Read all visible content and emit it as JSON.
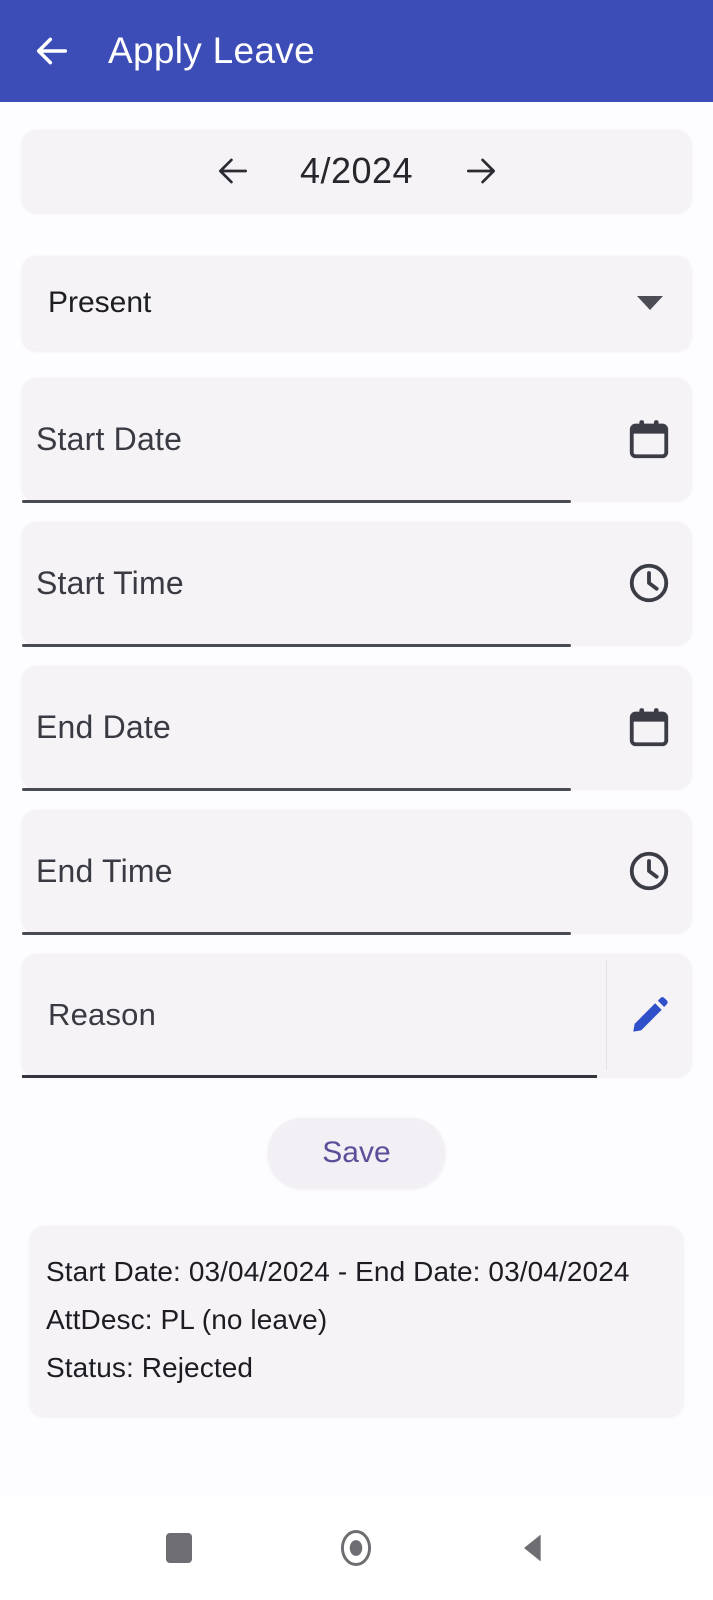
{
  "appbar": {
    "title": "Apply Leave",
    "back_icon": "arrow-left-icon",
    "background_color": "#3D4DB7",
    "title_color": "#FFFFFF"
  },
  "month_selector": {
    "prev_icon": "arrow-left-icon",
    "next_icon": "arrow-right-icon",
    "label": "4/2024"
  },
  "status_dropdown": {
    "selected": "Present",
    "caret_icon": "chevron-down-icon",
    "options": [
      "Present"
    ]
  },
  "fields": [
    {
      "label": "Start Date",
      "value": "",
      "icon": "calendar-icon",
      "name": "start-date-field"
    },
    {
      "label": "Start Time",
      "value": "",
      "icon": "clock-icon",
      "name": "start-time-field"
    },
    {
      "label": "End Date",
      "value": "",
      "icon": "calendar-icon",
      "name": "end-date-field"
    },
    {
      "label": "End Time",
      "value": "",
      "icon": "clock-icon",
      "name": "end-time-field"
    }
  ],
  "reason_field": {
    "label": "Reason",
    "value": "",
    "icon": "pencil-icon",
    "icon_color": "#2F50C8"
  },
  "save_button": {
    "label": "Save",
    "text_color": "#5D4E99",
    "background_color": "#F2EFF5"
  },
  "result_card": {
    "lines": [
      "Start Date: 03/04/2024 - End Date: 03/04/2024",
      "AttDesc: PL  (no leave)",
      "Status: Rejected"
    ]
  },
  "system_nav": {
    "recents_icon": "square-icon",
    "home_icon": "circle-icon",
    "back_icon": "triangle-left-icon"
  },
  "theme": {
    "page_background": "#FDFCFE",
    "card_background": "#F6F3F7",
    "accent": "#3D4DB7"
  }
}
